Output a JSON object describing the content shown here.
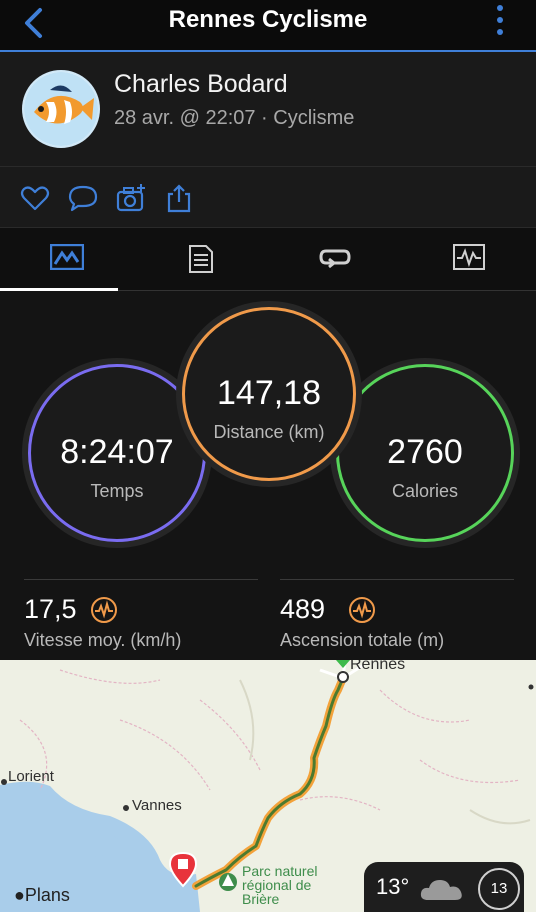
{
  "header": {
    "title": "Rennes Cyclisme",
    "back_icon": "chevron-left-icon",
    "menu_icon": "vertical-dots-icon",
    "accent": "#3f7fd8"
  },
  "profile": {
    "name": "Charles Bodard",
    "subtitle": "28 avr. @ 22:07 · Cyclisme"
  },
  "actions": [
    {
      "icon": "heart-icon"
    },
    {
      "icon": "comment-icon"
    },
    {
      "icon": "camera-add-icon"
    },
    {
      "icon": "share-icon"
    }
  ],
  "tabs": [
    {
      "icon": "summary-chart-icon",
      "active": true
    },
    {
      "icon": "details-list-icon",
      "active": false
    },
    {
      "icon": "laps-repeat-icon",
      "active": false
    },
    {
      "icon": "graph-icon",
      "active": false
    }
  ],
  "stats": {
    "time": {
      "value": "8:24:07",
      "label": "Temps",
      "color": "#7a6cf0"
    },
    "distance": {
      "value": "147,18",
      "label": "Distance (km)",
      "color": "#f09a4a"
    },
    "calories": {
      "value": "2760",
      "label": "Calories",
      "color": "#57d45a"
    }
  },
  "metrics": {
    "speed": {
      "value": "17,5",
      "label": "Vitesse moy. (km/h)",
      "icon": "pulse-icon"
    },
    "elevation": {
      "value": "489",
      "label": "Ascension totale (m)",
      "icon": "pulse-icon"
    }
  },
  "map": {
    "labels": {
      "rennes": "Rennes",
      "lorient": "Lorient",
      "vannes": "Vannes",
      "parc": [
        "Parc naturel",
        "régional de",
        "Brière"
      ]
    },
    "attribution": "Plans",
    "weather": {
      "temp": "13°",
      "aqi": "13"
    }
  }
}
